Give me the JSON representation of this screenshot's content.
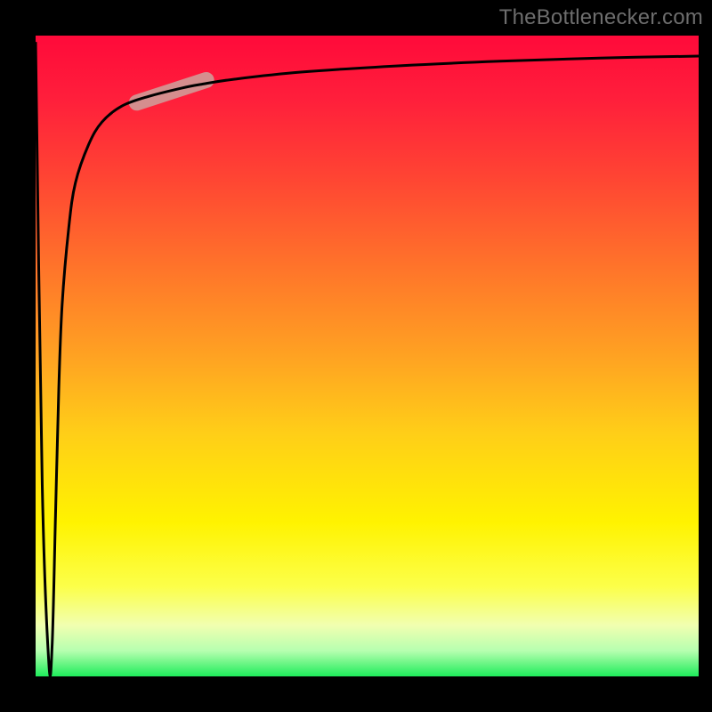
{
  "watermark": "TheBottlenecker.com",
  "chart_data": {
    "type": "line",
    "title": "",
    "xlabel": "",
    "ylabel": "",
    "xlim": [
      0,
      1
    ],
    "ylim": [
      0,
      1
    ],
    "grid": false,
    "series": [
      {
        "name": "bottleneck-curve",
        "x": [
          0.0,
          0.01,
          0.02,
          0.025,
          0.03,
          0.035,
          0.04,
          0.05,
          0.06,
          0.08,
          0.1,
          0.13,
          0.17,
          0.22,
          0.25,
          0.3,
          0.4,
          0.55,
          0.7,
          0.85,
          1.0
        ],
        "y": [
          0.99,
          0.3,
          0.02,
          0.05,
          0.25,
          0.45,
          0.58,
          0.7,
          0.77,
          0.83,
          0.865,
          0.89,
          0.905,
          0.918,
          0.924,
          0.932,
          0.943,
          0.953,
          0.96,
          0.965,
          0.968
        ]
      }
    ],
    "marker": {
      "cx": 0.205,
      "cy": 0.913,
      "length": 0.11,
      "angle_deg": 18,
      "color": "#d58e8e",
      "thickness": 18,
      "cap": "round"
    },
    "gradient_stops": [
      {
        "pos": 0.0,
        "color": "#ff0a3a"
      },
      {
        "pos": 0.1,
        "color": "#ff1f3b"
      },
      {
        "pos": 0.22,
        "color": "#ff4433"
      },
      {
        "pos": 0.38,
        "color": "#ff7a29"
      },
      {
        "pos": 0.5,
        "color": "#ffa222"
      },
      {
        "pos": 0.62,
        "color": "#ffce18"
      },
      {
        "pos": 0.76,
        "color": "#fff300"
      },
      {
        "pos": 0.86,
        "color": "#fcff4a"
      },
      {
        "pos": 0.92,
        "color": "#f1ffb0"
      },
      {
        "pos": 0.96,
        "color": "#b7ffb0"
      },
      {
        "pos": 1.0,
        "color": "#1eec5a"
      }
    ],
    "curve_style": {
      "stroke": "#000000",
      "width": 3
    }
  }
}
